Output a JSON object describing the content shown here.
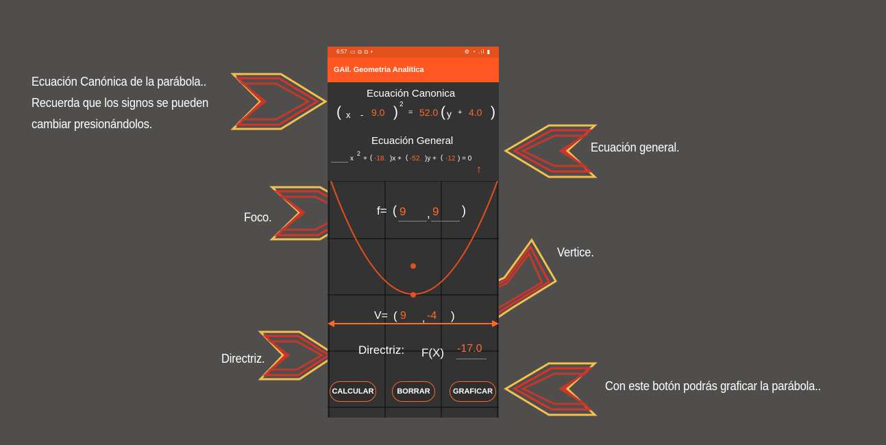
{
  "annotations": {
    "canonical": [
      "Ecuación Canónica de la parábola..",
      "Recuerda que los signos se pueden",
      "cambiar presionándolos."
    ],
    "general": "Ecuación general.",
    "focus": "Foco.",
    "vertex": "Vertice.",
    "directrix": "Directriz.",
    "graph_button": "Con este botón podrás graficar la parábola.."
  },
  "phone": {
    "status": {
      "time": "6:57",
      "left_icons": "▭ ◘ ◘ •",
      "right_icons": "⚙ ◔ .ıl ▮"
    },
    "app_title": "GAil. Geometria Analitica",
    "canonical": {
      "title": "Ecuación Canonica",
      "open_paren": "(",
      "x": "x",
      "sign1": "-",
      "h": "9.0",
      "close_paren": ")",
      "exponent": "2",
      "equals": "=",
      "p": "52.0",
      "open_paren2": "(",
      "y": "y",
      "sign2": "+",
      "k": "4.0",
      "close_paren2": ")"
    },
    "general": {
      "title": "Ecuación General",
      "x": "x",
      "exp": "2",
      "plus1": "+",
      "coef_d": "-18.",
      "x_suffix": ")x +",
      "coef_e": "-52.",
      "y_suffix": ")y +",
      "coef_f": "-12",
      "tail": ") = 0",
      "paren": "(",
      "arrow": "↑"
    },
    "focus": {
      "label": "f=",
      "open": "(",
      "x": "9",
      "comma": ",",
      "y": "9",
      "close": ")"
    },
    "vertex": {
      "label": "V=",
      "open": "(",
      "x": "9",
      "comma": ",",
      "y": "-4",
      "close": ")"
    },
    "directrix": {
      "label": "Directriz:",
      "fx": "F(X)",
      "value": "-17.0"
    },
    "buttons": {
      "calculate": "CALCULAR",
      "clear": "BORRAR",
      "graph": "GRAFICAR"
    }
  },
  "colors": {
    "accent": "#ff5722",
    "orange_text": "#ff6a2b",
    "background": "#4f4e4c",
    "arrow_yellow": "#f2c14e",
    "arrow_red": "#d8322a"
  }
}
